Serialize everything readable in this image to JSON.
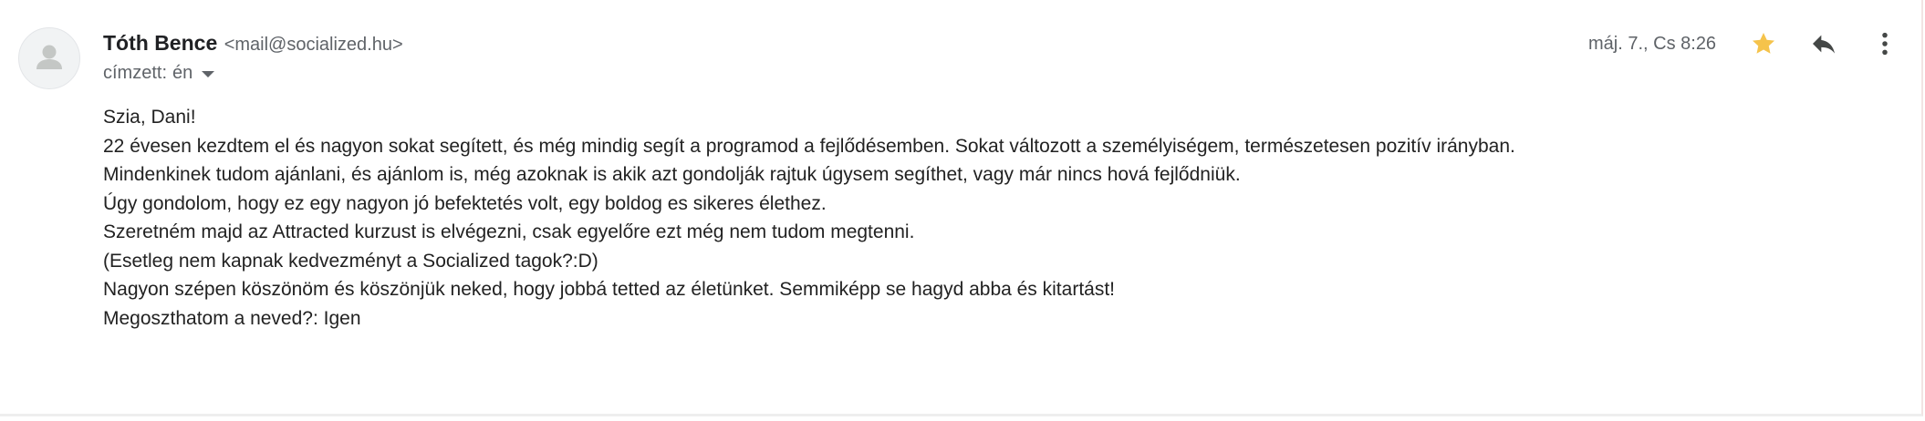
{
  "message": {
    "sender": {
      "name": "Tóth Bence",
      "email": "<mail@socialized.hu>"
    },
    "recipient": {
      "prefix": "címzett:",
      "value": "én"
    },
    "timestamp": "máj. 7., Cs 8:26",
    "starred": true,
    "body_lines": [
      "Szia, Dani!",
      "22 évesen kezdtem el és nagyon sokat segített, és még mindig segít a programod a fejlődésemben. Sokat változott a személyiségem, természetesen pozitív irányban.",
      "Mindenkinek tudom ajánlani, és ajánlom is, még azoknak is akik azt gondolják rajtuk úgysem segíthet, vagy már nincs hová fejlődniük.",
      "Úgy gondolom, hogy ez egy nagyon jó befektetés volt, egy boldog es sikeres élethez.",
      "Szeretném majd az Attracted kurzust is elvégezni, csak egyelőre ezt még nem tudom megtenni.",
      "(Esetleg nem kapnak kedvezményt a Socialized tagok?:D)",
      "Nagyon szépen köszönöm és köszönjük neked, hogy jobbá tetted az életünket. Semmiképp se hagyd abba és kitartást!",
      "Megoszthatom a neved?: Igen"
    ]
  },
  "icons": {
    "avatar": "person-icon",
    "star": "star-icon",
    "reply": "reply-icon",
    "more": "more-vert-icon"
  },
  "colors": {
    "star": "#f5c34b",
    "icon": "#444746",
    "secondary_text": "#5f6368",
    "primary_text": "#202124",
    "avatar_bg": "#f1f3f4",
    "avatar_fg": "#c4c7c5"
  }
}
